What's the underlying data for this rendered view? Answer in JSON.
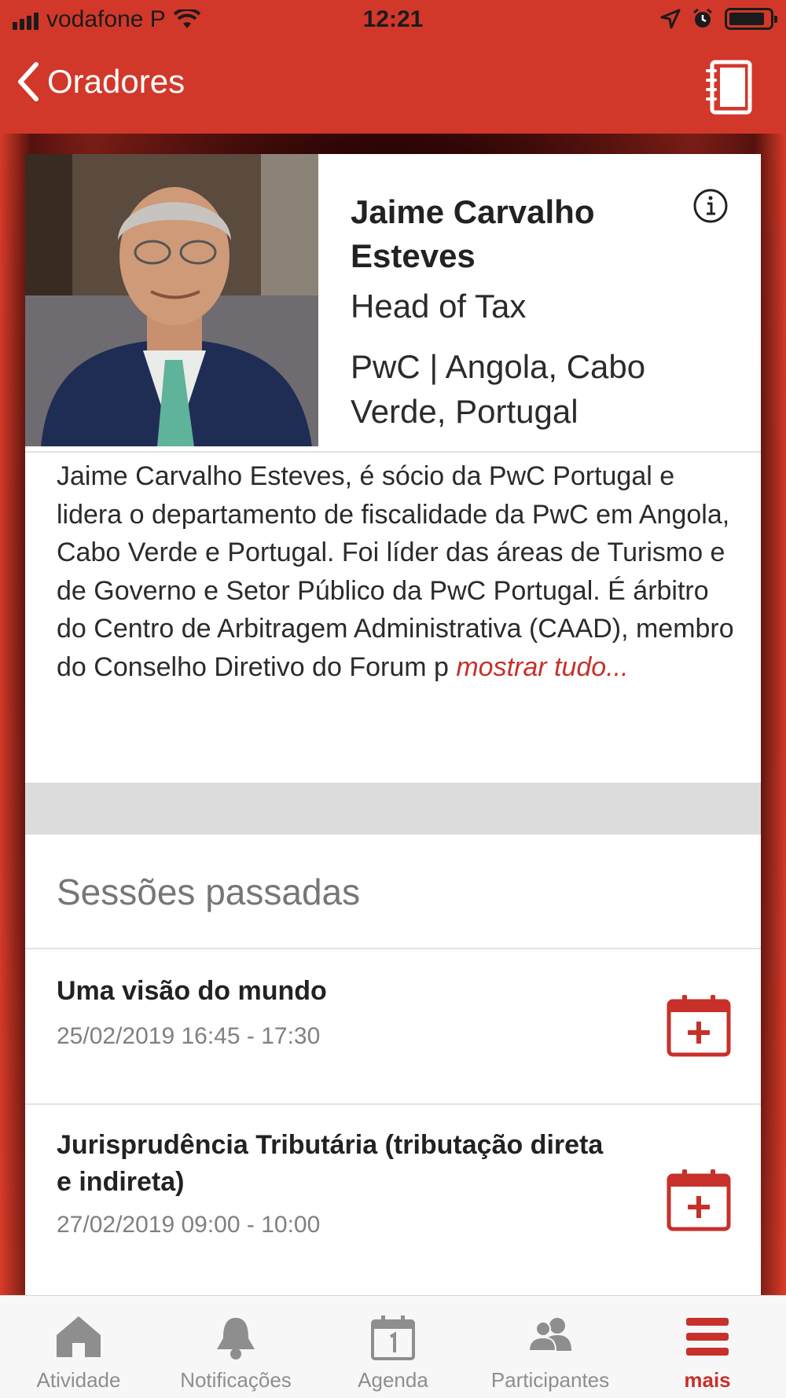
{
  "status_bar": {
    "carrier": "vodafone P",
    "time": "12:21"
  },
  "nav": {
    "back_label": "Oradores"
  },
  "speaker": {
    "name": "Jaime Carvalho Esteves",
    "role": "Head of Tax",
    "company": "PwC | Angola, Cabo Verde, Portugal",
    "bio": "Jaime Carvalho Esteves, é sócio da PwC Portugal e lidera o departamento de fiscalidade da PwC em Angola, Cabo Verde e Portugal. Foi líder das áreas de Turismo e de Governo e Setor Público da PwC Portugal. É árbitro do Centro de Arbitragem Administrativa (CAAD), membro do Conselho Diretivo do Forum p ",
    "show_more": "mostrar tudo..."
  },
  "sessions_section": {
    "title": "Sessões passadas",
    "items": [
      {
        "title": "Uma visão do mundo",
        "time": "25/02/2019 16:45 - 17:30"
      },
      {
        "title": "Jurisprudência Tributária (tributação direta e indireta)",
        "time": "27/02/2019 09:00 - 10:00"
      }
    ]
  },
  "tabs": [
    {
      "label": "Atividade",
      "icon": "home-icon"
    },
    {
      "label": "Notificações",
      "icon": "bell-icon"
    },
    {
      "label": "Agenda",
      "icon": "calendar-icon"
    },
    {
      "label": "Participantes",
      "icon": "people-icon"
    },
    {
      "label": "mais",
      "icon": "menu-icon",
      "active": true
    }
  ],
  "colors": {
    "accent": "#c8302a",
    "header": "#d2382a",
    "tab_inactive": "#8e8e8e"
  }
}
